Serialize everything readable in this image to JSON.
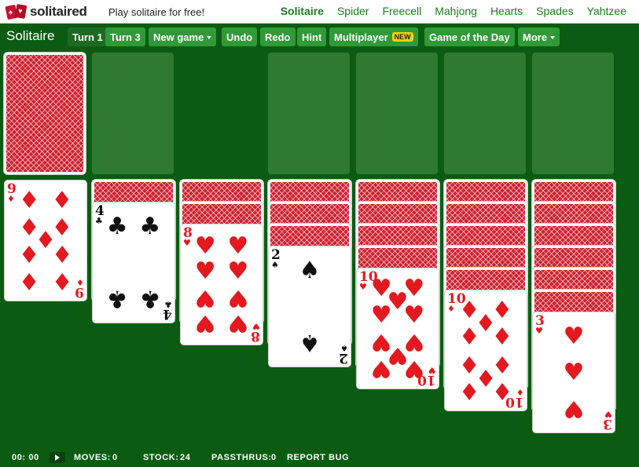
{
  "header": {
    "logo_text": "solitaired",
    "tagline": "Play solitaire for free!",
    "nav": [
      {
        "label": "Solitaire",
        "active": true
      },
      {
        "label": "Spider",
        "active": false
      },
      {
        "label": "Freecell",
        "active": false
      },
      {
        "label": "Mahjong",
        "active": false
      },
      {
        "label": "Hearts",
        "active": false
      },
      {
        "label": "Spades",
        "active": false
      },
      {
        "label": "Yahtzee",
        "active": false
      }
    ]
  },
  "toolbar": {
    "title": "Solitaire",
    "turn1": "Turn 1",
    "turn3": "Turn 3",
    "turn_selected": "Turn 1",
    "new_game": "New game",
    "undo": "Undo",
    "redo": "Redo",
    "hint": "Hint",
    "multiplayer": "Multiplayer",
    "new_badge": "NEW",
    "game_of_day": "Game of the Day",
    "more": "More"
  },
  "board": {
    "stock": {
      "face_down": true
    },
    "tableau": [
      {
        "hidden": 0,
        "top": {
          "rank": "9",
          "suit": "♦",
          "color": "red"
        }
      },
      {
        "hidden": 1,
        "top": {
          "rank": "4",
          "suit": "♣",
          "color": "black"
        }
      },
      {
        "hidden": 2,
        "top": {
          "rank": "8",
          "suit": "♥",
          "color": "red"
        }
      },
      {
        "hidden": 3,
        "top": {
          "rank": "2",
          "suit": "♠",
          "color": "black"
        }
      },
      {
        "hidden": 4,
        "top": {
          "rank": "10",
          "suit": "♥",
          "color": "red"
        }
      },
      {
        "hidden": 5,
        "top": {
          "rank": "10",
          "suit": "♦",
          "color": "red"
        }
      },
      {
        "hidden": 6,
        "top": {
          "rank": "3",
          "suit": "♥",
          "color": "red"
        }
      }
    ]
  },
  "status": {
    "time": "00: 00",
    "moves_label": "MOVES:",
    "moves": "0",
    "stock_label": "STOCK:",
    "stock": "24",
    "passthrus_label": "PASSTHRUS:",
    "passthrus": "0",
    "report_bug": "REPORT BUG"
  },
  "colors": {
    "felt": "#0b5c12",
    "button": "#2f9a37",
    "card_back": "#d0212f",
    "red_suit": "#e3191f",
    "badge": "#f5d20b"
  }
}
